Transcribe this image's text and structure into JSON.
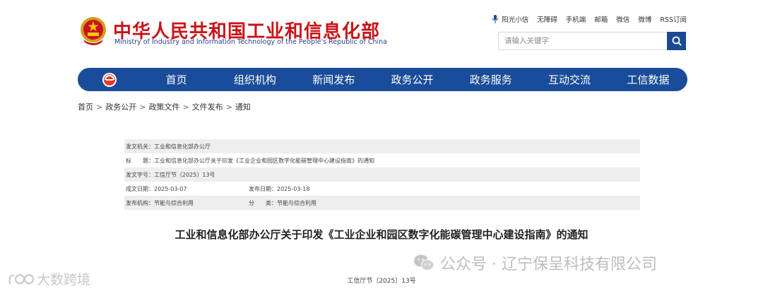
{
  "header": {
    "title": "中华人民共和国工业和信息化部",
    "subtitle": "Ministry of Industry and Information Technology of the People's Republic of China"
  },
  "toplinks": [
    "阳光小信",
    "无障碍",
    "手机端",
    "邮箱",
    "微信",
    "微博",
    "RSS订阅"
  ],
  "search": {
    "placeholder": "请输入关键字"
  },
  "nav": [
    "首页",
    "组织机构",
    "新闻发布",
    "政务公开",
    "政务服务",
    "互动交流",
    "工信数据"
  ],
  "breadcrumb": [
    "首页",
    "政务公开",
    "政策文件",
    "文件发布",
    "通知"
  ],
  "meta": {
    "issuer": "发文机关：工业和信息化部办公厅",
    "subject": "标　　题：工业和信息化部办公厅关于印发《工业企业和园区数字化能碳管理中心建设指南》的通知",
    "doc_no": "发文字号：工信厅节〔2025〕13号",
    "created": "成文日期：2025-03-07",
    "published": "发布日期：2025-03-18",
    "agency": "发布机构：节能与综合利用",
    "category": "分　　类：节能与综合利用"
  },
  "document": {
    "title": "工业和信息化部办公厅关于印发《工业企业和园区数字化能碳管理中心建设指南》的通知",
    "number": "工信厅节〔2025〕13号"
  },
  "watermarks": {
    "wechat": "公众号 · 辽宁保呈科技有限公司",
    "bigdata": "大数跨境"
  },
  "colors": {
    "brand_red": "#c9141a",
    "nav_blue": "#1a4d99",
    "search_blue": "#1b4a93"
  }
}
